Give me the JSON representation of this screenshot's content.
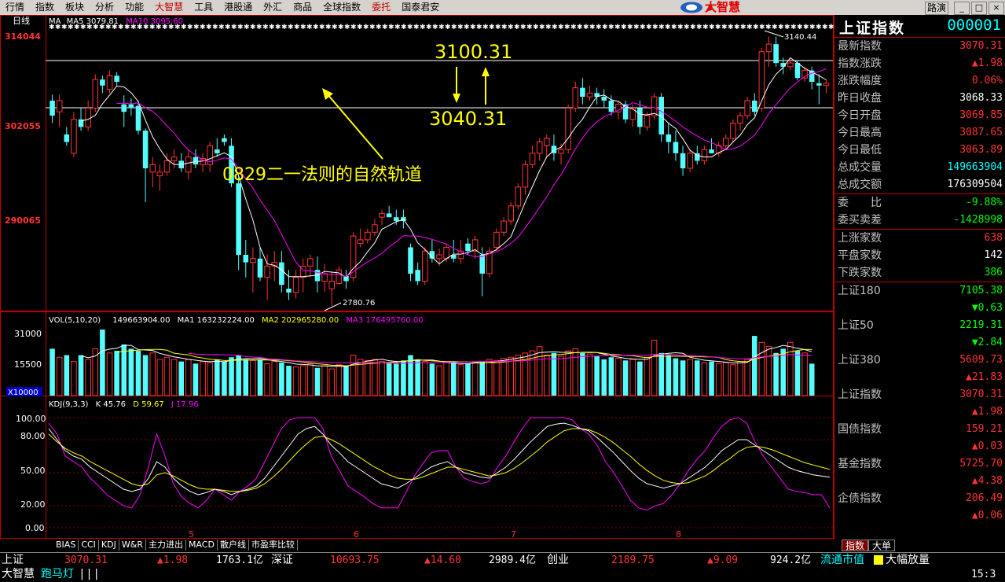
{
  "menu": {
    "items": [
      {
        "label": "行情",
        "accent": false
      },
      {
        "label": "指数",
        "accent": false
      },
      {
        "label": "板块",
        "accent": false
      },
      {
        "label": "分析",
        "accent": false
      },
      {
        "label": "功能",
        "accent": false
      },
      {
        "label": "大智慧",
        "accent": true
      },
      {
        "label": "工具",
        "accent": false
      },
      {
        "label": "港股通",
        "accent": false
      },
      {
        "label": "外汇",
        "accent": false
      },
      {
        "label": "商品",
        "accent": false
      },
      {
        "label": "全球指数",
        "accent": false
      },
      {
        "label": "委托",
        "accent": true
      },
      {
        "label": "国泰君安",
        "accent": false
      }
    ],
    "logo_text": "大智慧",
    "route_label": "路演",
    "min_label": "_",
    "max_label": "□",
    "close_label": "×"
  },
  "chart": {
    "period_label": "日线",
    "ma_legend": {
      "ma_label": "MA",
      "ma5": "MA5 3079.81",
      "ma10": "MA10 3095.60"
    },
    "vol_legend": {
      "label": "VOL(5,10,20)",
      "vol": "149663904.00",
      "ma1": "MA1 163232224.00",
      "ma2": "MA2 202965280.00",
      "ma3": "MA3 176495760.00"
    },
    "kdj_legend": {
      "label": "KDJ(9,3,3)",
      "k": "K 45.76",
      "d": "D 59.67",
      "j": "J 17.96"
    },
    "price_ticks": [
      "314044",
      "302055",
      "290065"
    ],
    "vol_ticks": [
      "31000",
      "15500"
    ],
    "vol_unit": "X10000",
    "kdj_ticks": [
      "100.00",
      "80.00",
      "50.00",
      "20.00",
      "0.00"
    ],
    "month_labels": [
      "5",
      "6",
      "7",
      "8"
    ],
    "annotations": {
      "upper_line": "3100.31",
      "lower_line": "3040.31",
      "rule_text": "0829二一法则的自然轨道",
      "high_label": "3140.44",
      "low_label": "2780.76"
    },
    "colors": {
      "up": "#ff3232",
      "down": "#54fcfc",
      "ma5": "#ffffff",
      "ma10": "#ff00ff",
      "ma20": "#ffff00",
      "frame": "#c00000",
      "annot": "#ffff00"
    }
  },
  "chart_data": {
    "type": "candlestick",
    "title": "上证指数",
    "price_range": [
      2780,
      3150
    ],
    "candles": [
      [
        3055,
        3063,
        3025,
        3035
      ],
      [
        3040,
        3063,
        3020,
        3055
      ],
      [
        3010,
        3020,
        2995,
        3000
      ],
      [
        2985,
        3040,
        2980,
        3030
      ],
      [
        3030,
        3045,
        3015,
        3020
      ],
      [
        3020,
        3055,
        3015,
        3045
      ],
      [
        3045,
        3090,
        3040,
        3083
      ],
      [
        3083,
        3088,
        3065,
        3075
      ],
      [
        3070,
        3095,
        3065,
        3088
      ],
      [
        3088,
        3093,
        3075,
        3080
      ],
      [
        3050,
        3062,
        3020,
        3040
      ],
      [
        3050,
        3058,
        3035,
        3045
      ],
      [
        3048,
        3055,
        3010,
        3015
      ],
      [
        3015,
        3018,
        2920,
        2965
      ],
      [
        2960,
        2980,
        2940,
        2970
      ],
      [
        2955,
        2970,
        2935,
        2960
      ],
      [
        2960,
        2985,
        2955,
        2975
      ],
      [
        2975,
        2990,
        2965,
        2980
      ],
      [
        2975,
        2985,
        2960,
        2965
      ],
      [
        2960,
        2990,
        2950,
        2980
      ],
      [
        2980,
        2990,
        2965,
        2970
      ],
      [
        2970,
        2985,
        2960,
        2978
      ],
      [
        2970,
        3000,
        2960,
        2995
      ],
      [
        2990,
        3005,
        2980,
        2985
      ],
      [
        3005,
        3010,
        2995,
        3000
      ],
      [
        2995,
        3005,
        2940,
        2945
      ],
      [
        2945,
        2955,
        2830,
        2850
      ],
      [
        2850,
        2870,
        2820,
        2840
      ],
      [
        2840,
        2860,
        2800,
        2845
      ],
      [
        2845,
        2860,
        2815,
        2820
      ],
      [
        2820,
        2850,
        2790,
        2835
      ],
      [
        2835,
        2855,
        2815,
        2840
      ],
      [
        2840,
        2855,
        2800,
        2810
      ],
      [
        2805,
        2830,
        2790,
        2800
      ],
      [
        2800,
        2830,
        2792,
        2820
      ],
      [
        2820,
        2845,
        2800,
        2835
      ],
      [
        2835,
        2850,
        2820,
        2845
      ],
      [
        2830,
        2848,
        2800,
        2815
      ],
      [
        2815,
        2838,
        2800,
        2825
      ],
      [
        2805,
        2828,
        2782,
        2815
      ],
      [
        2812,
        2835,
        2810,
        2830
      ],
      [
        2822,
        2830,
        2805,
        2815
      ],
      [
        2820,
        2880,
        2815,
        2875
      ],
      [
        2865,
        2885,
        2860,
        2870
      ],
      [
        2870,
        2885,
        2865,
        2880
      ],
      [
        2880,
        2898,
        2875,
        2890
      ],
      [
        2900,
        2910,
        2890,
        2905
      ],
      [
        2905,
        2915,
        2900,
        2900
      ],
      [
        2900,
        2910,
        2890,
        2895
      ],
      [
        2900,
        2910,
        2885,
        2895
      ],
      [
        2860,
        2865,
        2815,
        2825
      ],
      [
        2830,
        2840,
        2810,
        2815
      ],
      [
        2815,
        2860,
        2810,
        2855
      ],
      [
        2855,
        2870,
        2840,
        2845
      ],
      [
        2845,
        2858,
        2835,
        2850
      ],
      [
        2845,
        2865,
        2840,
        2860
      ],
      [
        2850,
        2870,
        2840,
        2845
      ],
      [
        2845,
        2870,
        2838,
        2855
      ],
      [
        2865,
        2872,
        2850,
        2855
      ],
      [
        2855,
        2875,
        2845,
        2870
      ],
      [
        2850,
        2860,
        2795,
        2825
      ],
      [
        2825,
        2860,
        2820,
        2855
      ],
      [
        2860,
        2885,
        2855,
        2880
      ],
      [
        2880,
        2900,
        2875,
        2895
      ],
      [
        2895,
        2920,
        2890,
        2915
      ],
      [
        2915,
        2945,
        2910,
        2940
      ],
      [
        2940,
        2975,
        2930,
        2970
      ],
      [
        2970,
        2995,
        2965,
        2985
      ],
      [
        2985,
        3005,
        2975,
        3000
      ],
      [
        2995,
        3010,
        2980,
        3005
      ],
      [
        2995,
        3010,
        2975,
        2985
      ],
      [
        2985,
        2998,
        2970,
        2990
      ],
      [
        2990,
        3050,
        2985,
        3045
      ],
      [
        3045,
        3080,
        3040,
        3072
      ],
      [
        3072,
        3085,
        3050,
        3060
      ],
      [
        3060,
        3075,
        3055,
        3065
      ],
      [
        3065,
        3072,
        3050,
        3060
      ],
      [
        3060,
        3070,
        3045,
        3055
      ],
      [
        3055,
        3062,
        3035,
        3040
      ],
      [
        3040,
        3055,
        3030,
        3050
      ],
      [
        3050,
        3055,
        3025,
        3030
      ],
      [
        3030,
        3050,
        3020,
        3045
      ],
      [
        3045,
        3055,
        3010,
        3020
      ],
      [
        3020,
        3040,
        3015,
        3035
      ],
      [
        3035,
        3065,
        3030,
        3060
      ],
      [
        3060,
        3065,
        3000,
        3010
      ],
      [
        3010,
        3025,
        2985,
        3000
      ],
      [
        3000,
        3015,
        2975,
        2985
      ],
      [
        2985,
        2995,
        2955,
        2965
      ],
      [
        2965,
        2990,
        2960,
        2985
      ],
      [
        2985,
        2995,
        2970,
        2975
      ],
      [
        2975,
        2995,
        2970,
        2990
      ],
      [
        2990,
        3005,
        2985,
        2985
      ],
      [
        2985,
        3000,
        2980,
        2995
      ],
      [
        2995,
        3010,
        2990,
        3005
      ],
      [
        3005,
        3030,
        3000,
        3025
      ],
      [
        3025,
        3040,
        3015,
        3035
      ],
      [
        3035,
        3060,
        3030,
        3055
      ],
      [
        3055,
        3065,
        3035,
        3040
      ],
      [
        3045,
        3125,
        3040,
        3120
      ],
      [
        3120,
        3140,
        3100,
        3130
      ],
      [
        3130,
        3140,
        3100,
        3105
      ],
      [
        3105,
        3112,
        3090,
        3100
      ],
      [
        3100,
        3110,
        3095,
        3105
      ],
      [
        3105,
        3108,
        3082,
        3085
      ],
      [
        3085,
        3100,
        3080,
        3095
      ],
      [
        3095,
        3100,
        3070,
        3080
      ],
      [
        3078,
        3090,
        3050,
        3075
      ],
      [
        3075,
        3082,
        3065,
        3078
      ]
    ],
    "volume_range": [
      0,
      31000
    ],
    "volume": [
      22000,
      18000,
      19000,
      16000,
      19000,
      17000,
      22000,
      31000,
      20000,
      21000,
      24000,
      22000,
      21000,
      19000,
      20000,
      17000,
      18000,
      17000,
      16000,
      17000,
      15000,
      16000,
      15500,
      17000,
      16000,
      18000,
      19000,
      17000,
      16500,
      17000,
      15000,
      16000,
      15500,
      14000,
      13500,
      14000,
      15000,
      13000,
      14000,
      12500,
      14500,
      14000,
      19000,
      17000,
      16500,
      17000,
      16000,
      15500,
      15000,
      16500,
      19000,
      17000,
      16000,
      15000,
      14000,
      15500,
      16000,
      14500,
      15000,
      15500,
      16000,
      17000,
      16500,
      17500,
      18000,
      19000,
      20000,
      21000,
      23000,
      19000,
      20000,
      18500,
      21000,
      22000,
      20000,
      19500,
      18500,
      17000,
      18000,
      17500,
      16500,
      17000,
      16000,
      18000,
      26000,
      20000,
      19000,
      17500,
      16500,
      17000,
      16500,
      15500,
      16000,
      15000,
      15500,
      14500,
      16000,
      17000,
      28000,
      25000,
      23000,
      20000,
      22000,
      25000,
      21000,
      20000,
      15000
    ],
    "kdj_range": [
      0,
      100
    ],
    "k": [
      90,
      80,
      70,
      65,
      62,
      55,
      50,
      45,
      40,
      35,
      33,
      35,
      45,
      60,
      55,
      45,
      38,
      33,
      30,
      32,
      35,
      33,
      30,
      33,
      35,
      38,
      45,
      55,
      65,
      75,
      85,
      90,
      92,
      85,
      75,
      68,
      60,
      55,
      50,
      45,
      40,
      38,
      36,
      40,
      45,
      50,
      55,
      58,
      60,
      55,
      50,
      48,
      46,
      45,
      50,
      55,
      62,
      70,
      78,
      85,
      92,
      94,
      95,
      93,
      90,
      88,
      82,
      75,
      68,
      60,
      52,
      45,
      40,
      38,
      36,
      38,
      40,
      45,
      50,
      55,
      62,
      70,
      75,
      80,
      80,
      75,
      70,
      65,
      60,
      55,
      52,
      50,
      48,
      47,
      46
    ],
    "d": [
      85,
      78,
      72,
      68,
      65,
      60,
      56,
      52,
      48,
      44,
      40,
      38,
      40,
      48,
      50,
      47,
      43,
      39,
      36,
      35,
      35,
      34,
      33,
      33,
      34,
      36,
      40,
      46,
      53,
      61,
      69,
      76,
      82,
      83,
      80,
      76,
      71,
      66,
      61,
      56,
      52,
      48,
      45,
      44,
      44,
      46,
      49,
      52,
      55,
      55,
      53,
      51,
      49,
      47,
      48,
      50,
      54,
      59,
      65,
      71,
      78,
      83,
      88,
      90,
      90,
      89,
      86,
      82,
      77,
      71,
      65,
      58,
      52,
      47,
      43,
      41,
      40,
      41,
      44,
      47,
      52,
      58,
      63,
      69,
      73,
      74,
      73,
      71,
      68,
      65,
      62,
      59,
      57,
      55,
      53
    ],
    "j": [
      95,
      85,
      65,
      60,
      55,
      45,
      38,
      30,
      25,
      20,
      18,
      30,
      55,
      85,
      65,
      40,
      28,
      22,
      18,
      25,
      35,
      30,
      25,
      33,
      38,
      45,
      60,
      75,
      90,
      98,
      100,
      100,
      100,
      90,
      65,
      52,
      38,
      33,
      28,
      22,
      18,
      18,
      18,
      32,
      47,
      58,
      68,
      70,
      70,
      55,
      45,
      42,
      40,
      42,
      55,
      65,
      78,
      90,
      100,
      100,
      100,
      100,
      100,
      98,
      90,
      85,
      75,
      60,
      50,
      38,
      25,
      18,
      16,
      20,
      22,
      30,
      40,
      52,
      62,
      70,
      82,
      92,
      98,
      100,
      95,
      78,
      65,
      55,
      45,
      35,
      33,
      32,
      30,
      30,
      17.96
    ]
  },
  "quote": {
    "name": "上证指数",
    "code": "000001",
    "rows1": [
      {
        "label": "最新指数",
        "value": "3070.31",
        "color": "#ff3232"
      },
      {
        "label": "指数涨跌",
        "value": "▲1.98",
        "color": "#ff3232"
      },
      {
        "label": "涨跌幅度",
        "value": "0.06%",
        "color": "#ff3232"
      },
      {
        "label": "昨日收盘",
        "value": "3068.33",
        "color": "#ffffff"
      },
      {
        "label": "今日开盘",
        "value": "3069.85",
        "color": "#ff3232"
      },
      {
        "label": "今日最高",
        "value": "3087.65",
        "color": "#ff3232"
      },
      {
        "label": "今日最低",
        "value": "3063.89",
        "color": "#ff3232"
      },
      {
        "label": "总成交量",
        "value": "149663904",
        "color": "#00ffff"
      },
      {
        "label": "总成交额",
        "value": "176309504",
        "color": "#ffffff"
      }
    ],
    "rows2": [
      {
        "label": "委　　比",
        "value": "-9.88%",
        "color": "#00ff00"
      },
      {
        "label": "委买卖差",
        "value": "-1428998",
        "color": "#00ff00"
      }
    ],
    "rows3": [
      {
        "label": "上涨家数",
        "value": "638",
        "color": "#ff3232"
      },
      {
        "label": "平盘家数",
        "value": "142",
        "color": "#ffffff"
      },
      {
        "label": "下跌家数",
        "value": "386",
        "color": "#00ff00"
      }
    ],
    "indices": [
      {
        "label": "上证180",
        "value": "7105.38",
        "change": "▼0.63",
        "vcolor": "#00ff00"
      },
      {
        "label": "上证50",
        "value": "2219.31",
        "change": "▼2.84",
        "vcolor": "#00ff00"
      },
      {
        "label": "上证380",
        "value": "5609.73",
        "change": "▲21.83",
        "vcolor": "#ff3232"
      },
      {
        "label": "上证指数",
        "value": "3070.31",
        "change": "▲1.98",
        "vcolor": "#ff3232"
      },
      {
        "label": "国债指数",
        "value": "159.21",
        "change": "▲0.03",
        "vcolor": "#ff3232"
      },
      {
        "label": "基金指数",
        "value": "5725.70",
        "change": "▲4.38",
        "vcolor": "#ff3232"
      },
      {
        "label": "企债指数",
        "value": "206.49",
        "change": "▲0.06",
        "vcolor": "#ff3232"
      }
    ],
    "tabs": [
      "指数",
      "大单"
    ]
  },
  "bottom_tabs": [
    "BIAS",
    "CCI",
    "KDJ",
    "W&R",
    "主力进出",
    "MACD",
    "散户线",
    "市盈率比较"
  ],
  "status": {
    "sh_label": "上证",
    "sh_value": "3070.31",
    "sh_change": "▲1.98",
    "sh_amount": "1763.1亿",
    "sz_label": "深证",
    "sz_value": "10693.75",
    "sz_change": "▲14.60",
    "sz_amount": "2989.4亿",
    "cy_label": "创业",
    "cy_value": "2189.75",
    "cy_change": "▲9.09",
    "cy_amount": "924.2亿",
    "ltsz_label": "流通市值",
    "dfz_label": "大幅放量",
    "brand_label": "大智慧",
    "marquee_label": "跑马灯",
    "marquee_marks": "| | |",
    "clock": "15:3"
  }
}
